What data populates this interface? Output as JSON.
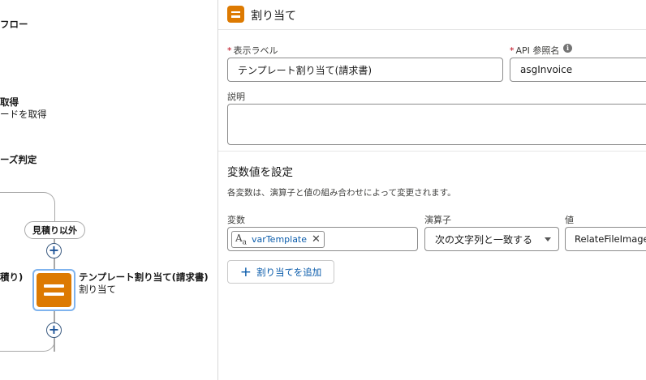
{
  "canvas": {
    "flow_title_partial": "フロー",
    "get_title_partial": "取得",
    "get_sub_partial": "ードを取得",
    "decision_title_partial": "ーズ判定",
    "branch_pill_label": "見積り以外",
    "left_branch_partial": "積り)",
    "node": {
      "title": "テンプレート割り当て(請求書)",
      "type": "割り当て",
      "icon": "equals-icon",
      "color": "#dd7a01"
    },
    "plus_symbol": "+"
  },
  "panel": {
    "header": {
      "title": "割り当て",
      "icon": "assignment-icon"
    },
    "fields": {
      "label_field": {
        "label": "表示ラベル",
        "required_mark": "*",
        "value": "テンプレート割り当て(請求書)"
      },
      "api_field": {
        "label": "API 参照名",
        "required_mark": "*",
        "value": "asgInvoice",
        "info_icon": "i"
      },
      "description_field": {
        "label": "説明",
        "value": ""
      }
    },
    "section": {
      "title": "変数値を設定",
      "description": "各変数は、演算子と値の組み合わせによって変更されます。"
    },
    "assignment_row": {
      "variable_label": "変数",
      "operator_label": "演算子",
      "value_label": "値",
      "variable_chip": {
        "icon_text": "A",
        "icon_sub": "a",
        "label": "varTemplate",
        "remove": "✕"
      },
      "operator_value": "次の文字列と一致する",
      "value_value": "RelateFileImage"
    },
    "add_button": {
      "plus": "+",
      "label": "割り当てを追加"
    }
  }
}
